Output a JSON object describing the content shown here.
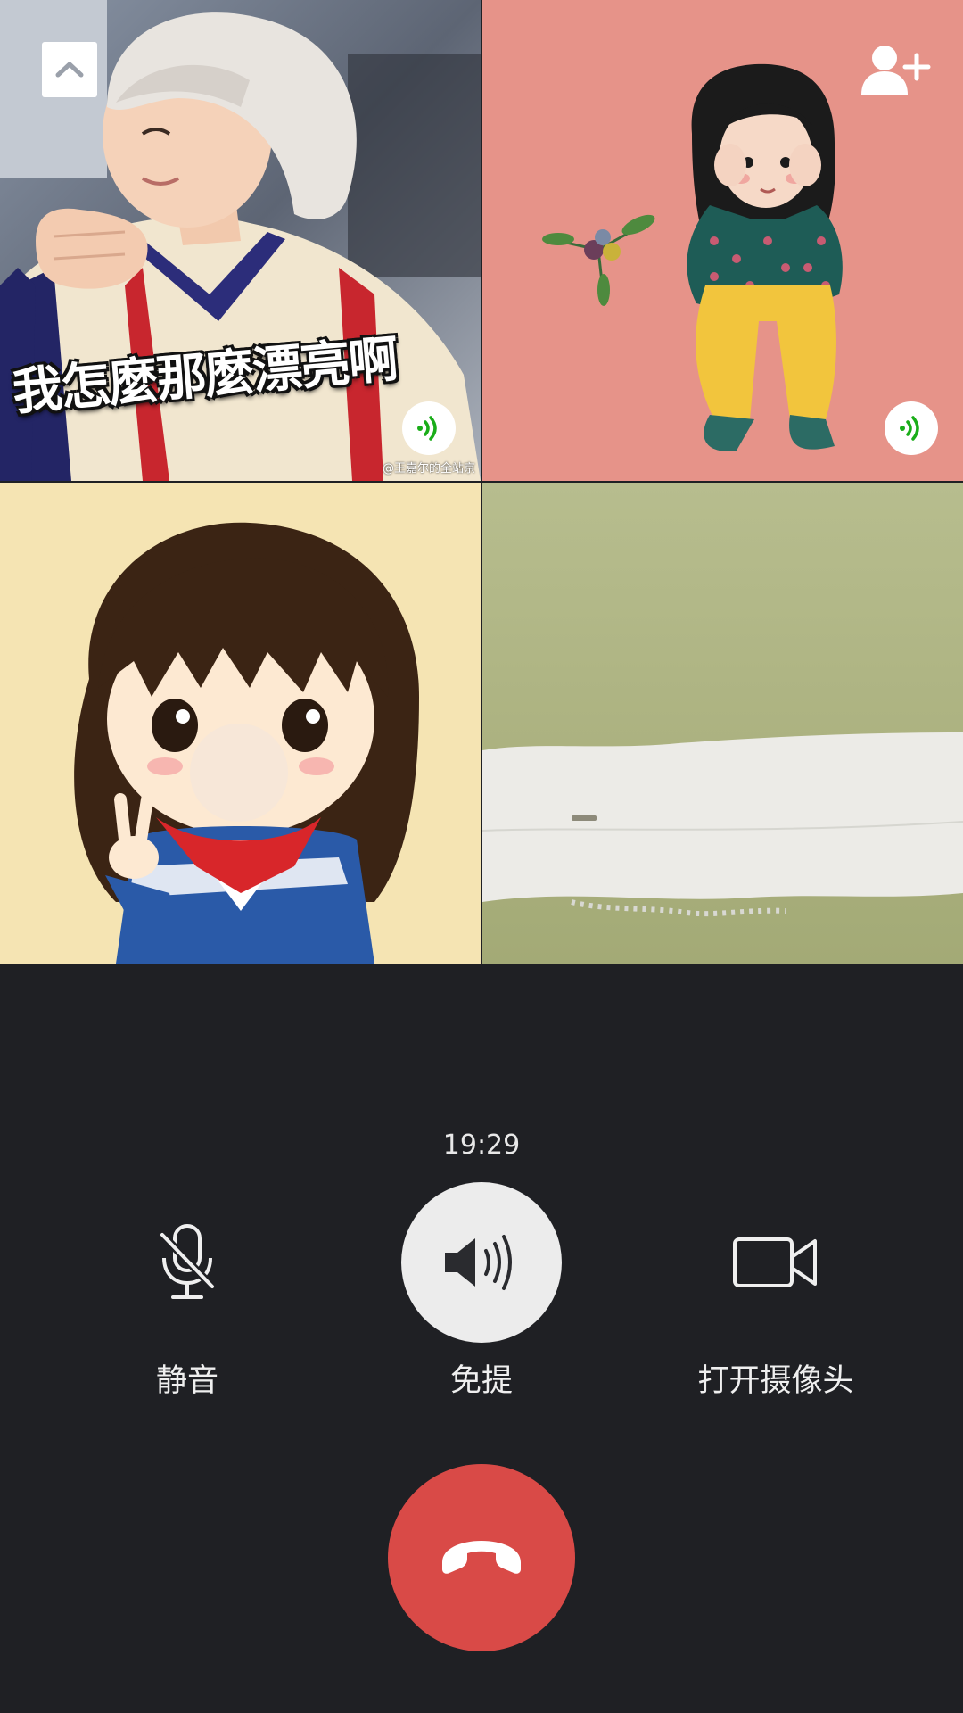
{
  "participants": [
    {
      "name": "participant-1",
      "caption": "我怎麼那麼漂亮啊",
      "watermark": "@王嘉尔的全站京",
      "speaking": true
    },
    {
      "name": "participant-2",
      "speaking": true
    },
    {
      "name": "participant-3",
      "speaking": false
    },
    {
      "name": "participant-4",
      "speaking": false
    }
  ],
  "header": {
    "collapse_icon": "chevron-up-icon",
    "add_member_icon": "add-person-icon"
  },
  "call": {
    "timer": "19:29",
    "controls": {
      "mute_label": "静音",
      "speaker_label": "免提",
      "camera_label": "打开摄像头"
    },
    "hangup_icon": "hang-up-icon"
  },
  "colors": {
    "background": "#1f2024",
    "hangup": "#d94a47",
    "speaking_green": "#1aad19",
    "speaker_active": "#ececec"
  }
}
